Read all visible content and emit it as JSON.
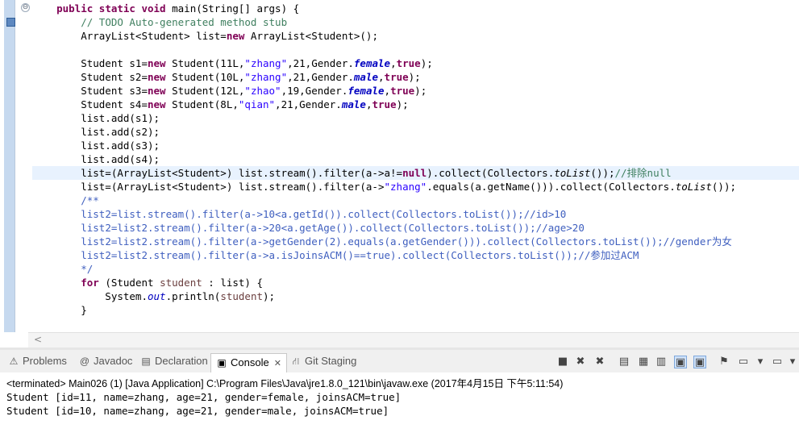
{
  "editor": {
    "fold_symbol": "⊖",
    "lines": [
      [
        {
          "t": "    "
        },
        {
          "t": "public",
          "c": "kw"
        },
        {
          "t": " "
        },
        {
          "t": "static",
          "c": "kw"
        },
        {
          "t": " "
        },
        {
          "t": "void",
          "c": "kw"
        },
        {
          "t": " main(String[] args) {"
        }
      ],
      [
        {
          "t": "        "
        },
        {
          "t": "// TODO Auto-generated method stub",
          "c": "cm"
        }
      ],
      [
        {
          "t": "        ArrayList<Student> list="
        },
        {
          "t": "new",
          "c": "kw"
        },
        {
          "t": " ArrayList<Student>();"
        }
      ],
      [
        {
          "t": ""
        }
      ],
      [
        {
          "t": "        Student s1="
        },
        {
          "t": "new",
          "c": "kw"
        },
        {
          "t": " Student(11L,"
        },
        {
          "t": "\"zhang\"",
          "c": "st"
        },
        {
          "t": ",21,Gender."
        },
        {
          "t": "female",
          "c": "fi"
        },
        {
          "t": ","
        },
        {
          "t": "true",
          "c": "kw"
        },
        {
          "t": ");"
        }
      ],
      [
        {
          "t": "        Student s2="
        },
        {
          "t": "new",
          "c": "kw"
        },
        {
          "t": " Student(10L,"
        },
        {
          "t": "\"zhang\"",
          "c": "st"
        },
        {
          "t": ",21,Gender."
        },
        {
          "t": "male",
          "c": "fi"
        },
        {
          "t": ","
        },
        {
          "t": "true",
          "c": "kw"
        },
        {
          "t": ");"
        }
      ],
      [
        {
          "t": "        Student s3="
        },
        {
          "t": "new",
          "c": "kw"
        },
        {
          "t": " Student(12L,"
        },
        {
          "t": "\"zhao\"",
          "c": "st"
        },
        {
          "t": ",19,Gender."
        },
        {
          "t": "female",
          "c": "fi"
        },
        {
          "t": ","
        },
        {
          "t": "true",
          "c": "kw"
        },
        {
          "t": ");"
        }
      ],
      [
        {
          "t": "        Student s4="
        },
        {
          "t": "new",
          "c": "kw"
        },
        {
          "t": " Student(8L,"
        },
        {
          "t": "\"qian\"",
          "c": "st"
        },
        {
          "t": ",21,Gender."
        },
        {
          "t": "male",
          "c": "fi"
        },
        {
          "t": ","
        },
        {
          "t": "true",
          "c": "kw"
        },
        {
          "t": ");"
        }
      ],
      [
        {
          "t": "        list.add(s1);"
        }
      ],
      [
        {
          "t": "        list.add(s2);"
        }
      ],
      [
        {
          "t": "        list.add(s3);"
        }
      ],
      [
        {
          "t": "        list.add(s4);"
        }
      ],
      [
        {
          "t": "        list=(ArrayList<Student>) list.stream().filter(a->a!="
        },
        {
          "t": "null",
          "c": "kw"
        },
        {
          "t": ").collect(Collectors."
        },
        {
          "t": "toList",
          "c": "it"
        },
        {
          "t": "());"
        },
        {
          "t": "//排除null",
          "c": "cm"
        }
      ],
      [
        {
          "t": "        list=(ArrayList<Student>) list.stream().filter(a->"
        },
        {
          "t": "\"zhang\"",
          "c": "st"
        },
        {
          "t": ".equals(a.getName())).collect(Collectors."
        },
        {
          "t": "toList",
          "c": "it"
        },
        {
          "t": "());"
        }
      ],
      [
        {
          "t": "        "
        },
        {
          "t": "/**",
          "c": "jd"
        }
      ],
      [
        {
          "t": "        "
        },
        {
          "t": "list2=list.stream().filter(a->10<a.getId()).collect(Collectors.toList());//id>10",
          "c": "jd"
        }
      ],
      [
        {
          "t": "        "
        },
        {
          "t": "list2=list2.stream().filter(a->20<a.getAge()).collect(Collectors.toList());//age>20",
          "c": "jd"
        }
      ],
      [
        {
          "t": "        "
        },
        {
          "t": "list2=list2.stream().filter(a->getGender(2).equals(a.getGender())).collect(Collectors.toList());//gender为女",
          "c": "jd"
        }
      ],
      [
        {
          "t": "        "
        },
        {
          "t": "list2=list2.stream().filter(a->a.isJoinsACM()==true).collect(Collectors.toList());//参加过ACM",
          "c": "jd"
        }
      ],
      [
        {
          "t": "        "
        },
        {
          "t": "*/",
          "c": "jd"
        }
      ],
      [
        {
          "t": "        "
        },
        {
          "t": "for",
          "c": "kw"
        },
        {
          "t": " (Student "
        },
        {
          "t": "student",
          "c": "lv"
        },
        {
          "t": " : list) {"
        }
      ],
      [
        {
          "t": "            System."
        },
        {
          "t": "out",
          "c": "ou"
        },
        {
          "t": ".println("
        },
        {
          "t": "student",
          "c": "lv"
        },
        {
          "t": ");"
        }
      ],
      [
        {
          "t": "        }"
        }
      ]
    ],
    "current_line_index": 12,
    "scroll_left_label": "<"
  },
  "panel": {
    "tabs": [
      {
        "name": "problems",
        "icon": "⚠",
        "label": "Problems",
        "active": false
      },
      {
        "name": "javadoc",
        "icon": "@",
        "label": "Javadoc",
        "active": false
      },
      {
        "name": "declaration",
        "icon": "▤",
        "label": "Declaration",
        "active": false
      },
      {
        "name": "console",
        "icon": "▣",
        "label": "Console",
        "active": true,
        "close": "✕"
      },
      {
        "name": "git-staging",
        "icon": "⛙",
        "label": "Git Staging",
        "active": false
      }
    ],
    "toolbar": [
      {
        "name": "terminate-icon",
        "glyph": "■"
      },
      {
        "name": "remove-launch-icon",
        "glyph": "✖"
      },
      {
        "name": "remove-all-terminated-icon",
        "glyph": "✖"
      },
      {
        "name": "clear-console-icon",
        "glyph": "▤"
      },
      {
        "name": "scroll-lock-icon",
        "glyph": "▦"
      },
      {
        "name": "word-wrap-icon",
        "glyph": "▥"
      },
      {
        "name": "show-on-stdout-icon",
        "glyph": "▣"
      },
      {
        "name": "show-on-stderr-icon",
        "glyph": "▣"
      },
      {
        "name": "pin-console-icon",
        "glyph": "⚑"
      },
      {
        "name": "display-console-icon",
        "glyph": "▭"
      },
      {
        "name": "display-console-dropdown-icon",
        "glyph": "▾"
      },
      {
        "name": "open-console-icon",
        "glyph": "▭"
      },
      {
        "name": "open-console-dropdown-icon",
        "glyph": "▾"
      }
    ]
  },
  "console": {
    "status": "<terminated> Main026 (1) [Java Application] C:\\Program Files\\Java\\jre1.8.0_121\\bin\\javaw.exe (2017年4月15日 下午5:11:54)",
    "output": [
      "Student [id=11, name=zhang, age=21, gender=female, joinsACM=true]",
      "Student [id=10, name=zhang, age=21, gender=male, joinsACM=true]"
    ]
  }
}
